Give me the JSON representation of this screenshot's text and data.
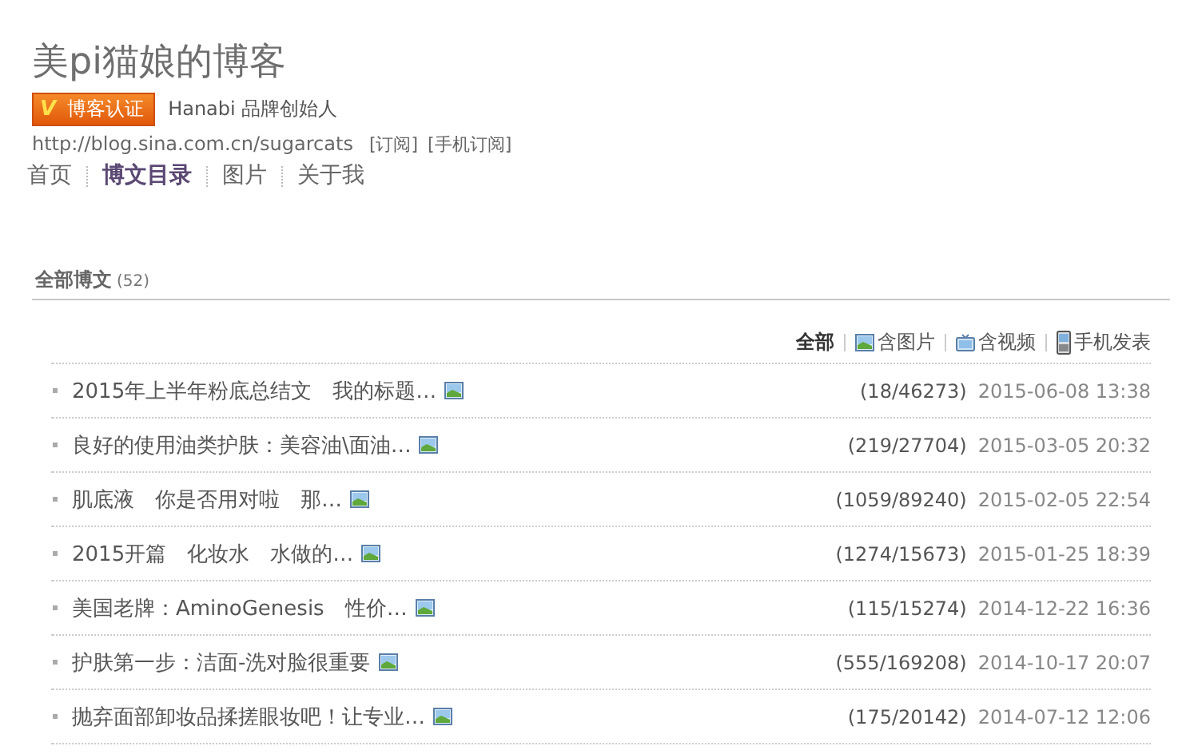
{
  "blog": {
    "title": "美pi猫娘的博客",
    "badge": {
      "mark": "V",
      "label": "博客认证"
    },
    "description": "Hanabi 品牌创始人",
    "url": "http://blog.sina.com.cn/sugarcats",
    "links": [
      "[订阅]",
      "[手机订阅]"
    ]
  },
  "nav": [
    {
      "label": "首页",
      "selected": false
    },
    {
      "label": "博文目录",
      "selected": true
    },
    {
      "label": "图片",
      "selected": false
    },
    {
      "label": "关于我",
      "selected": false
    }
  ],
  "section": {
    "title": "全部博文",
    "count": "(52)"
  },
  "filters": [
    {
      "kind": "all",
      "label": "全部",
      "selected": true
    },
    {
      "kind": "image",
      "label": "含图片",
      "selected": false
    },
    {
      "kind": "video",
      "label": "含视频",
      "selected": false
    },
    {
      "kind": "phone",
      "label": "手机发表",
      "selected": false
    }
  ],
  "posts": [
    {
      "title": "2015年上半年粉底总结文　我的标题…",
      "has_image": true,
      "stats": "(18/46273)",
      "date": "2015-06-08 13:38"
    },
    {
      "title": "良好的使用油类护肤：美容油\\面油…",
      "has_image": true,
      "stats": "(219/27704)",
      "date": "2015-03-05 20:32"
    },
    {
      "title": "肌底液　你是否用对啦　那…",
      "has_image": true,
      "stats": "(1059/89240)",
      "date": "2015-02-05 22:54"
    },
    {
      "title": "2015开篇　化妆水　水做的…",
      "has_image": true,
      "stats": "(1274/15673)",
      "date": "2015-01-25 18:39"
    },
    {
      "title": "美国老牌：AminoGenesis　性价…",
      "has_image": true,
      "stats": "(115/15274)",
      "date": "2014-12-22 16:36"
    },
    {
      "title": "护肤第一步：洁面-洗对脸很重要",
      "has_image": true,
      "stats": "(555/169208)",
      "date": "2014-10-17 20:07"
    },
    {
      "title": "抛弃面部卸妆品揉搓眼妆吧！让专业…",
      "has_image": true,
      "stats": "(175/20142)",
      "date": "2014-07-12 12:06"
    }
  ]
}
